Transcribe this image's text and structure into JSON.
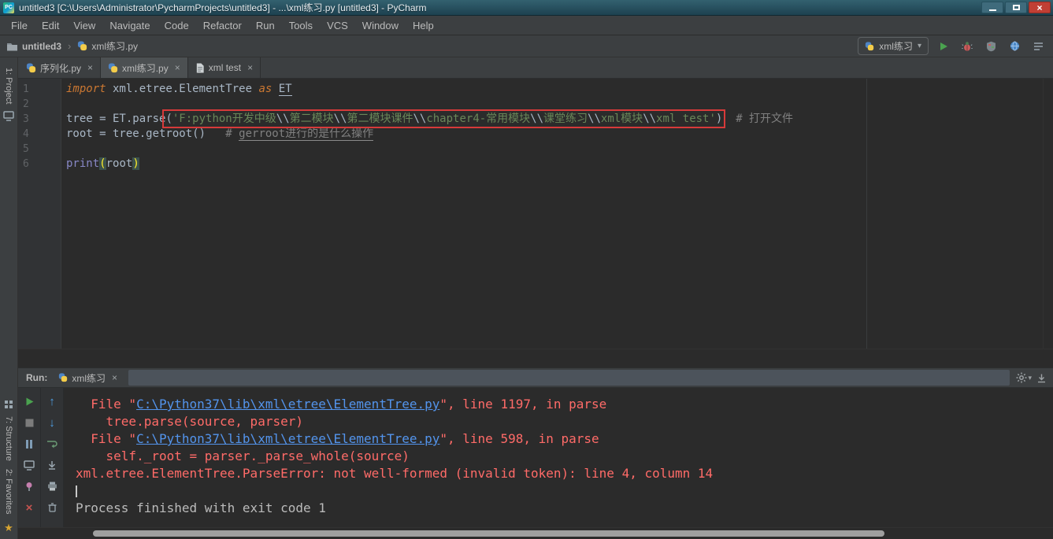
{
  "window": {
    "logo": "PC",
    "title": "untitled3 [C:\\Users\\Administrator\\PycharmProjects\\untitled3] - ...\\xml练习.py [untitled3] - PyCharm",
    "close": "×"
  },
  "icons": {
    "dropdown_arrow": "▾",
    "chevron": "›",
    "close": "×",
    "star": "★",
    "up_arrow": "↑",
    "down_arrow": "↓"
  },
  "menus": [
    "File",
    "Edit",
    "View",
    "Navigate",
    "Code",
    "Refactor",
    "Run",
    "Tools",
    "VCS",
    "Window",
    "Help"
  ],
  "navbar": {
    "project": "untitled3",
    "separator": "›",
    "file": "xml练习.py"
  },
  "run_config": {
    "name": "xml练习"
  },
  "tool_stripe": {
    "project": "1: Project",
    "structure": "7: Structure",
    "favorites": "2: Favorites"
  },
  "editor_tabs": [
    {
      "label": "序列化.py",
      "icon": "python",
      "close": "×",
      "active": false
    },
    {
      "label": "xml练习.py",
      "icon": "python",
      "close": "×",
      "active": true
    },
    {
      "label": "xml test",
      "icon": "text",
      "close": "×",
      "active": false
    }
  ],
  "editor": {
    "lines": [
      {
        "n": "1",
        "tokens": [
          {
            "c": "kw",
            "t": "import"
          },
          {
            "t": " xml.etree.ElementTree "
          },
          {
            "c": "kw",
            "t": "as"
          },
          {
            "t": " "
          },
          {
            "c": "und",
            "t": "ET"
          }
        ]
      },
      {
        "n": "2",
        "tokens": []
      },
      {
        "n": "3",
        "tokens": [
          {
            "t": "tree = ET.parse"
          },
          {
            "group": true,
            "cls": "red-annotation",
            "name": "error-annotation-box",
            "tokens": [
              {
                "t": "("
              },
              {
                "c": "str",
                "t": "'F:python开发中级"
              },
              {
                "c": "esc",
                "t": "\\\\"
              },
              {
                "c": "str",
                "t": "第二模块"
              },
              {
                "c": "esc",
                "t": "\\\\"
              },
              {
                "c": "str",
                "t": "第二模块课件"
              },
              {
                "c": "esc",
                "t": "\\\\"
              },
              {
                "c": "str",
                "t": "chapter4-常用模块"
              },
              {
                "c": "esc",
                "t": "\\\\"
              },
              {
                "c": "str",
                "t": "课堂练习"
              },
              {
                "c": "esc",
                "t": "\\\\"
              },
              {
                "c": "str",
                "t": "xml模块"
              },
              {
                "c": "esc",
                "t": "\\\\"
              },
              {
                "c": "str",
                "t": "xml test'"
              },
              {
                "t": ")"
              }
            ]
          },
          {
            "t": "  "
          },
          {
            "c": "com",
            "t": "# 打开文件"
          }
        ]
      },
      {
        "n": "4",
        "tokens": [
          {
            "t": "root = tree.getroot()   "
          },
          {
            "c": "com",
            "t": "# "
          },
          {
            "c": "com undl",
            "t": "gerroot"
          },
          {
            "c": "com undl",
            "t": "进行的是什么操作"
          }
        ]
      },
      {
        "n": "5",
        "tokens": []
      },
      {
        "n": "6",
        "tokens": [
          {
            "c": "builtin",
            "t": "print"
          },
          {
            "c": "match",
            "t": "("
          },
          {
            "t": "root"
          },
          {
            "c": "match",
            "t": ")"
          }
        ]
      }
    ]
  },
  "run_panel": {
    "label": "Run:",
    "tab": {
      "label": "xml练习",
      "close": "×"
    }
  },
  "console": {
    "lines": [
      {
        "tokens": [
          {
            "c": "err",
            "t": "  File \""
          },
          {
            "c": "lnk",
            "t": "C:\\Python37\\lib\\xml\\etree\\ElementTree.py"
          },
          {
            "c": "err",
            "t": "\", line 1197, in parse"
          }
        ]
      },
      {
        "tokens": [
          {
            "c": "err",
            "t": "    tree.parse(source, parser)"
          }
        ]
      },
      {
        "tokens": [
          {
            "c": "err",
            "t": "  File \""
          },
          {
            "c": "lnk",
            "t": "C:\\Python37\\lib\\xml\\etree\\ElementTree.py"
          },
          {
            "c": "err",
            "t": "\", line 598, in parse"
          }
        ]
      },
      {
        "tokens": [
          {
            "c": "err",
            "t": "    self._root = parser._parse_whole(source)"
          }
        ]
      },
      {
        "tokens": [
          {
            "c": "err",
            "t": "xml.etree.ElementTree.ParseError: not well-formed (invalid token): line 4, column 14"
          }
        ]
      },
      {
        "tokens": [
          {
            "c": "caret",
            "t": ""
          }
        ]
      },
      {
        "tokens": [
          {
            "c": "out",
            "t": "Process finished with exit code 1"
          }
        ]
      }
    ]
  },
  "colors": {
    "chrome_bg": "#3c3f41",
    "editor_bg": "#2b2b2b",
    "keyword_orange": "#cc7832",
    "string_green": "#6a8759",
    "comment_gray": "#808080",
    "builtin_purple": "#8888c6",
    "error_red": "#ff6b68",
    "link_blue": "#5394ec",
    "annotation_red": "#d73a3a"
  }
}
